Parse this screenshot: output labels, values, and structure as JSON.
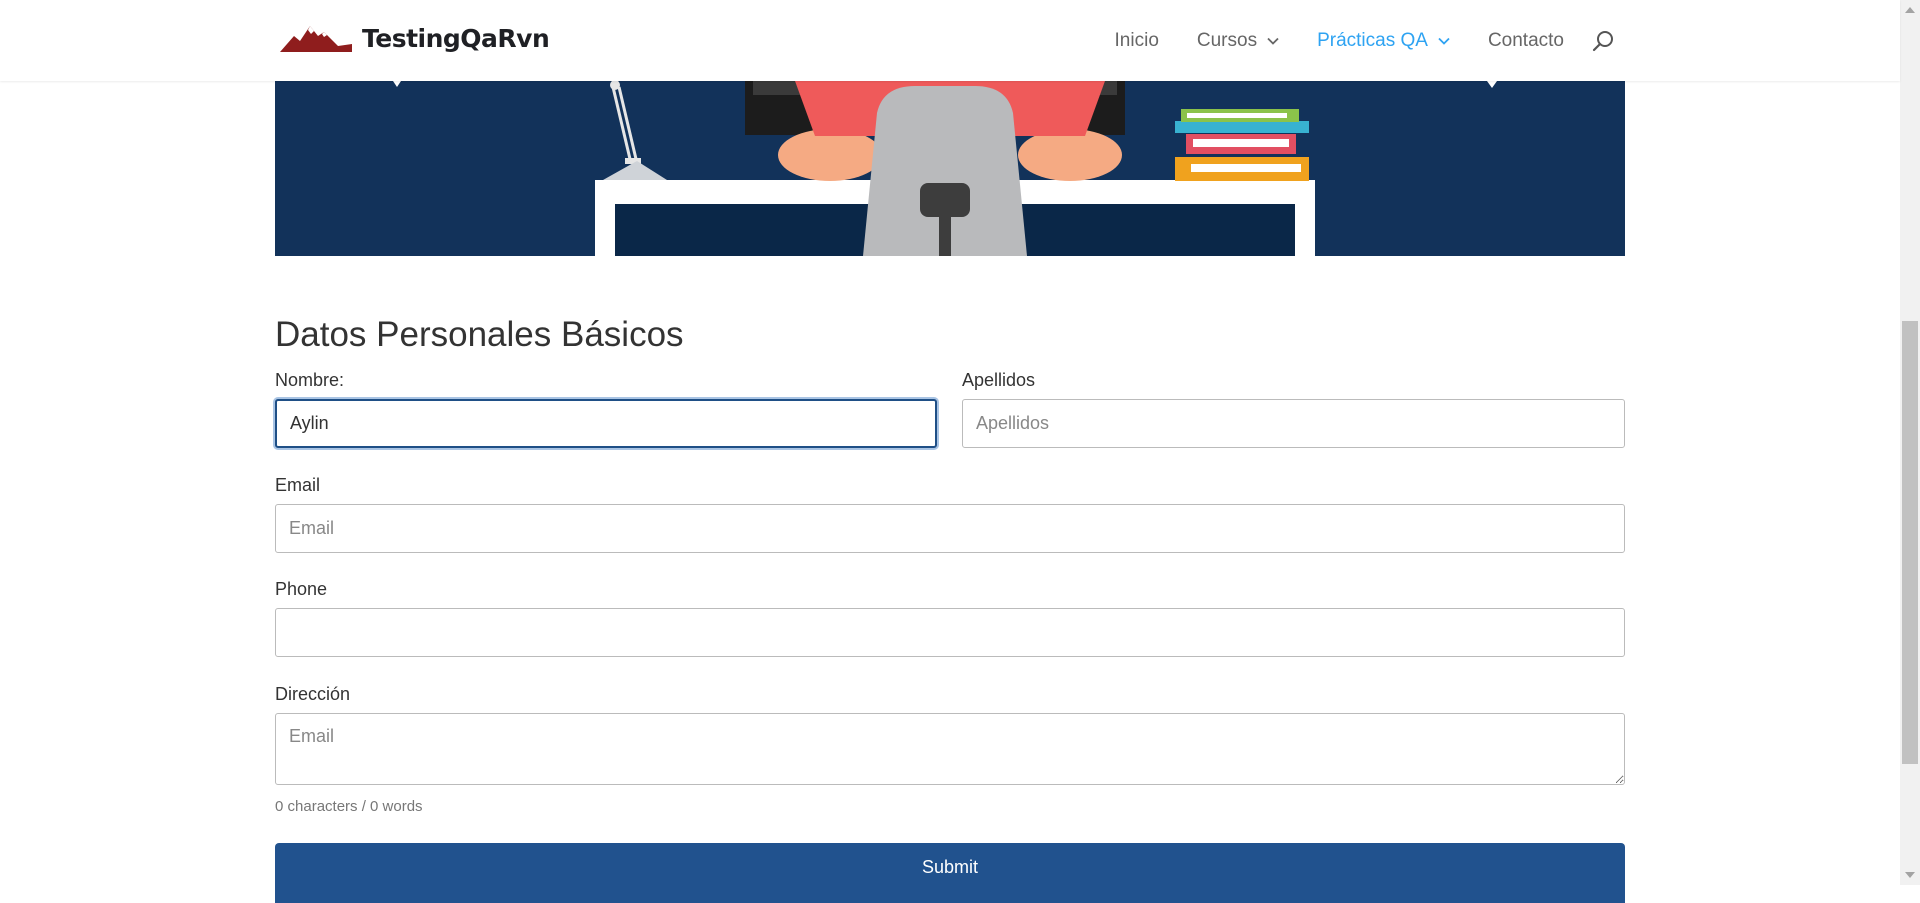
{
  "header": {
    "logo_text": "TestingQaRvn",
    "nav": [
      {
        "label": "Inicio"
      },
      {
        "label": "Cursos"
      },
      {
        "label": "Prácticas QA"
      },
      {
        "label": "Contacto"
      }
    ],
    "active_nav": "Prácticas QA",
    "accent_color": "#2ea3f2"
  },
  "form": {
    "title": "Datos Personales Básicos",
    "nombre": {
      "label": "Nombre:",
      "value": "Aylin"
    },
    "apellidos": {
      "label": "Apellidos",
      "placeholder": "Apellidos",
      "value": ""
    },
    "email": {
      "label": "Email",
      "placeholder": "Email",
      "value": ""
    },
    "phone": {
      "label": "Phone",
      "placeholder": "",
      "value": ""
    },
    "direccion": {
      "label": "Dirección",
      "placeholder": "Email",
      "value": ""
    },
    "counter": "0 characters / 0 words",
    "submit_label": "Submit",
    "submit_color": "#21528e"
  },
  "icons": {
    "search": "search-icon",
    "dropdown": "chevron-down-icon",
    "logo": "mountain-logo-icon"
  }
}
